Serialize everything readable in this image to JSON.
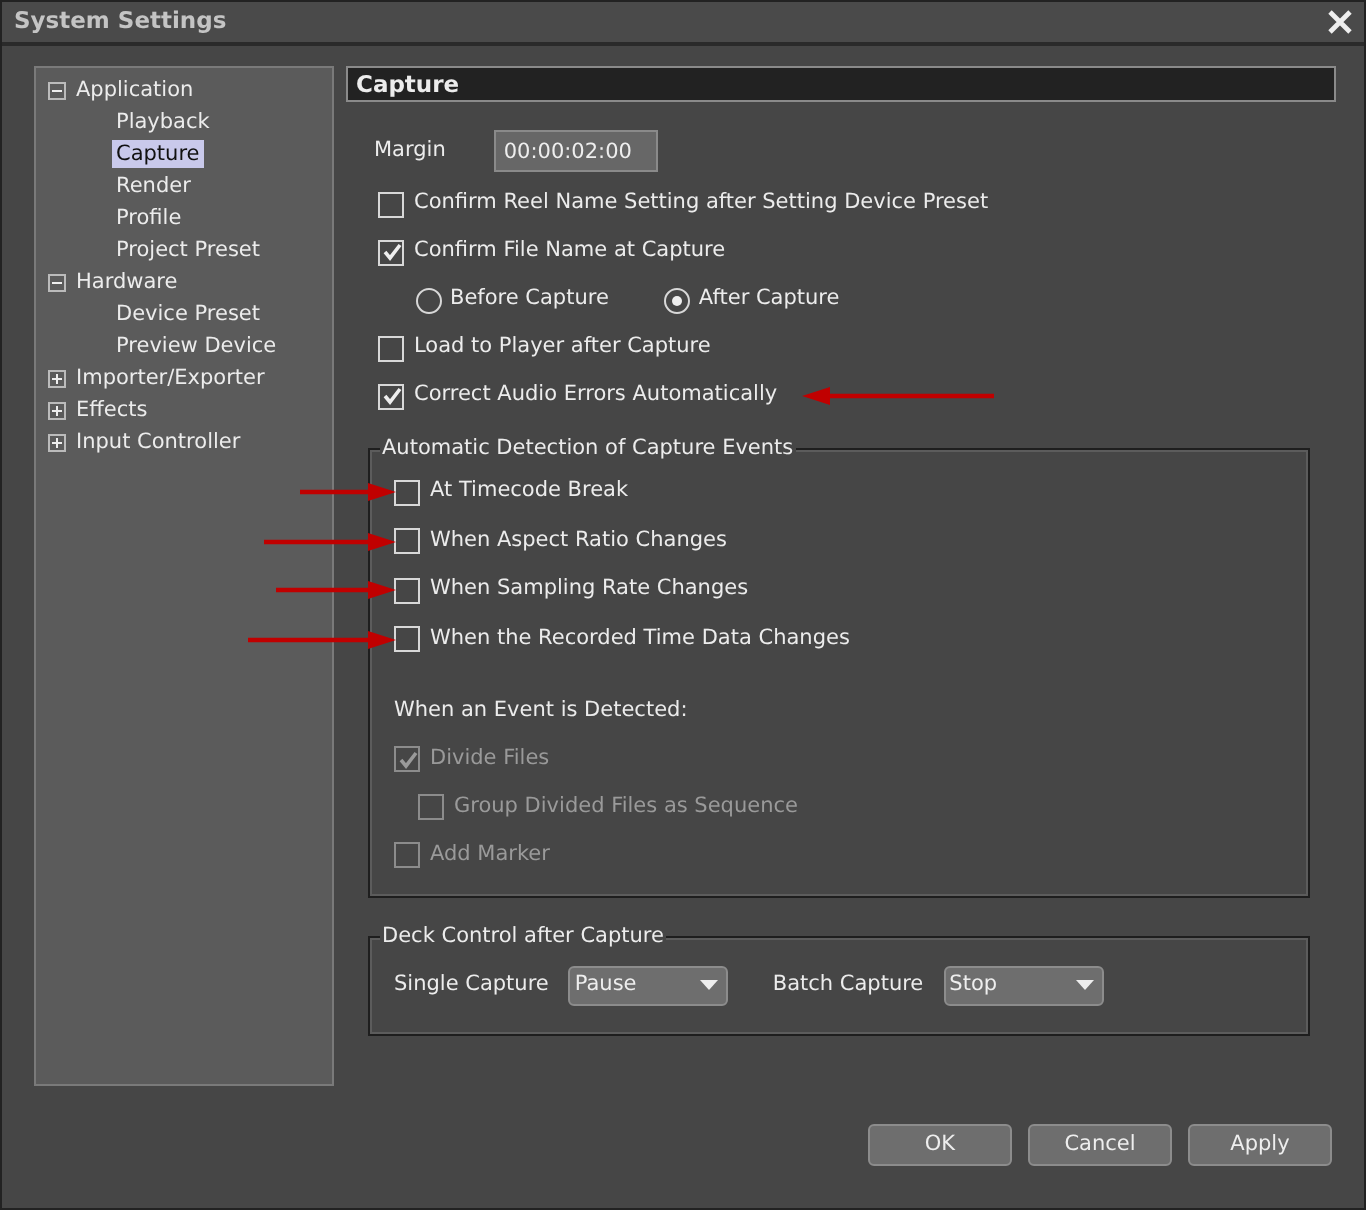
{
  "window": {
    "title": "System Settings"
  },
  "tree": [
    {
      "label": "Application",
      "expanded": true,
      "selected": false,
      "children": [
        {
          "label": "Playback",
          "selected": false
        },
        {
          "label": "Capture",
          "selected": true
        },
        {
          "label": "Render",
          "selected": false
        },
        {
          "label": "Profile",
          "selected": false
        },
        {
          "label": "Project Preset",
          "selected": false
        }
      ]
    },
    {
      "label": "Hardware",
      "expanded": true,
      "selected": false,
      "children": [
        {
          "label": "Device Preset",
          "selected": false
        },
        {
          "label": "Preview Device",
          "selected": false
        }
      ]
    },
    {
      "label": "Importer/Exporter",
      "expanded": false,
      "selected": false
    },
    {
      "label": "Effects",
      "expanded": false,
      "selected": false
    },
    {
      "label": "Input Controller",
      "expanded": false,
      "selected": false
    }
  ],
  "section_title": "Capture",
  "margin": {
    "label": "Margin",
    "value": "00:00:02:00"
  },
  "options": [
    {
      "kind": "checkbox",
      "label": "Confirm Reel Name Setting after Setting Device Preset",
      "checked": false,
      "annotated": false
    },
    {
      "kind": "checkbox",
      "label": "Confirm File Name at Capture",
      "checked": true,
      "annotated": false
    },
    {
      "kind": "radios",
      "items": [
        {
          "label": "Before Capture",
          "selected": false
        },
        {
          "label": "After Capture",
          "selected": true
        }
      ]
    },
    {
      "kind": "checkbox",
      "label": "Load to Player after Capture",
      "checked": false,
      "annotated": false
    },
    {
      "kind": "checkbox",
      "label": "Correct Audio Errors Automatically",
      "checked": true,
      "annotated": true
    }
  ],
  "detection": {
    "title": "Automatic Detection of Capture Events",
    "events": [
      {
        "label": "At Timecode Break",
        "checked": false,
        "annotated": true
      },
      {
        "label": "When Aspect Ratio Changes",
        "checked": false,
        "annotated": true
      },
      {
        "label": "When Sampling Rate Changes",
        "checked": false,
        "annotated": true
      },
      {
        "label": "When the Recorded Time Data Changes",
        "checked": false,
        "annotated": true
      }
    ],
    "subtitle": "When an Event is Detected:",
    "actions": [
      {
        "label": "Divide Files",
        "checked": true,
        "disabled": true,
        "children": [
          {
            "label": "Group Divided Files as Sequence",
            "checked": false,
            "disabled": true
          }
        ]
      },
      {
        "label": "Add Marker",
        "checked": false,
        "disabled": true
      }
    ]
  },
  "deck": {
    "title": "Deck Control after Capture",
    "controls": [
      {
        "label": "Single Capture",
        "value": "Pause"
      },
      {
        "label": "Batch Capture",
        "value": "Stop"
      }
    ]
  },
  "buttons": [
    "OK",
    "Cancel",
    "Apply"
  ]
}
